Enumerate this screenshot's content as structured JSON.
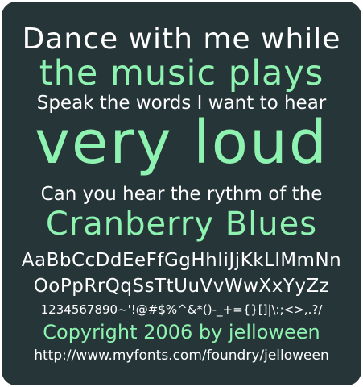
{
  "specimen": {
    "line1": "Dance with me while",
    "line2": "the music plays",
    "line3": "Speak the words I want to hear",
    "line4": "very loud",
    "line5": "Can you hear the rythm of the",
    "line6": "Cranberry Blues",
    "alphabet1": "AaBbCcDdEeFfGgHhIiJjKkLlMmNn",
    "alphabet2": "OoPpRrQqSsTtUuVvWwXxYyZz",
    "symbols": "1234567890~'!@#$%^&*()-_+={}[]|\\:;<>,.?/",
    "copyright": "Copyright 2006 by jelloween",
    "url": "http://www.myfonts.com/foundry/jelloween"
  },
  "colors": {
    "background": "#263538",
    "white_text": "#ffffff",
    "green_text": "#8ef2b0"
  }
}
